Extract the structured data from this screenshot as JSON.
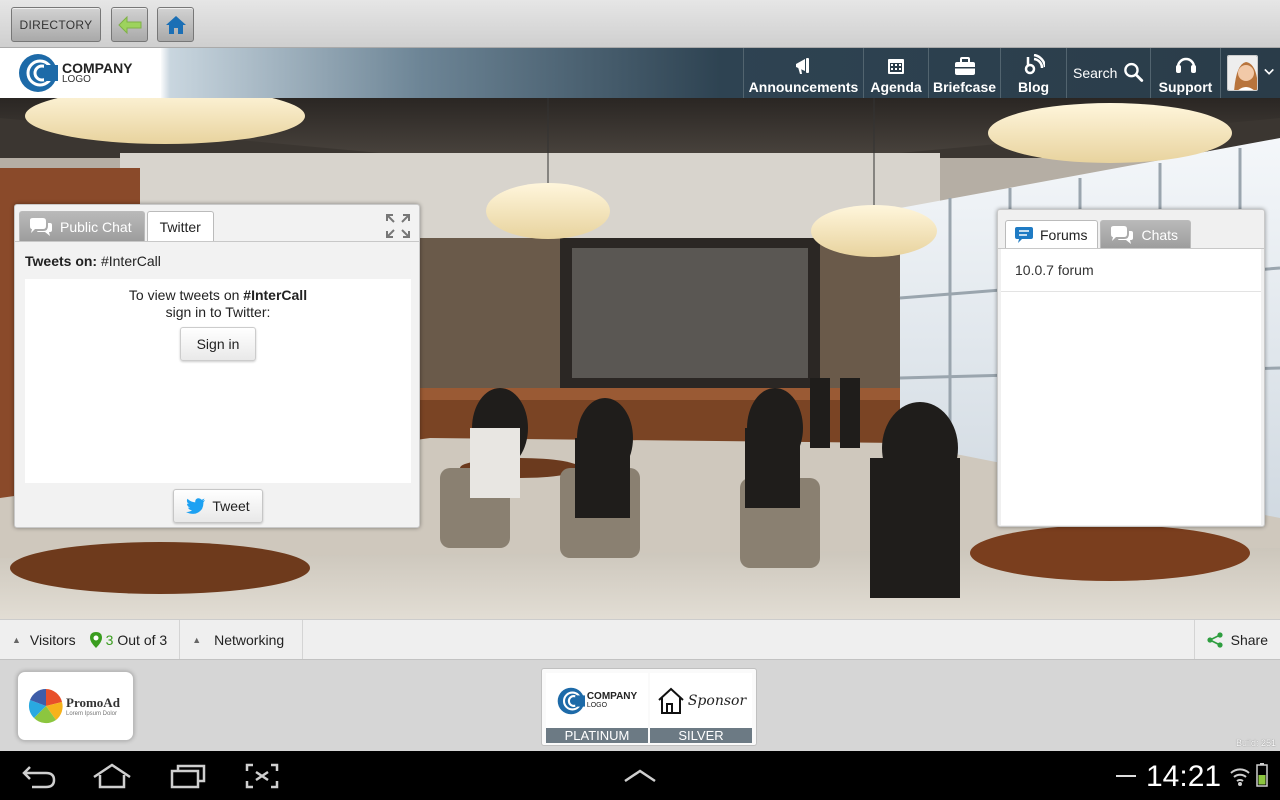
{
  "topbar": {
    "directory_label": "DIRECTORY",
    "back_icon": "back-arrow-icon",
    "home_icon": "home-icon"
  },
  "header": {
    "logo": {
      "line1": "COMPANY",
      "line2": "LOGO"
    },
    "nav": [
      {
        "label": "Announcements",
        "icon": "megaphone-icon"
      },
      {
        "label": "Agenda",
        "icon": "calendar-icon"
      },
      {
        "label": "Briefcase",
        "icon": "briefcase-icon"
      },
      {
        "label": "Blog",
        "icon": "blog-icon"
      },
      {
        "label": "Search",
        "icon": "search-icon"
      },
      {
        "label": "Support",
        "icon": "headset-icon"
      }
    ]
  },
  "twitter_panel": {
    "tabs": [
      {
        "label": "Public Chat",
        "active": false
      },
      {
        "label": "Twitter",
        "active": true
      }
    ],
    "tweets_on_label": "Tweets on:",
    "hashtag": "#InterCall",
    "message_line1_prefix": "To view tweets on ",
    "message_hashtag": "#InterCall",
    "message_line2": "sign in to Twitter:",
    "sign_in_label": "Sign in",
    "tweet_label": "Tweet"
  },
  "forums_panel": {
    "tabs": [
      {
        "label": "Forums",
        "active": true
      },
      {
        "label": "Chats",
        "active": false
      }
    ],
    "items": [
      "10.0.7 forum"
    ]
  },
  "statusbar": {
    "visitors_label": "Visitors",
    "visitors_count": "3",
    "visitors_suffix": "Out of 3",
    "networking_label": "Networking",
    "share_label": "Share"
  },
  "sponsors": {
    "promo": {
      "title": "PromoAd",
      "subtitle": "Lorem Ipsum Dolor"
    },
    "items": [
      {
        "tier": "PLATINUM",
        "logo_line1": "COMPANY",
        "logo_line2": "LOGO"
      },
      {
        "tier": "SILVER",
        "logo_text": "Sponsor"
      }
    ],
    "build": "Build: 251"
  },
  "system": {
    "time": "14:21"
  },
  "colors": {
    "header_dark": "#2a3c49",
    "twitter_blue": "#1da1f2",
    "visitors_green": "#3a9d1f",
    "share_green": "#2e9e3f",
    "forums_blue": "#1f7bc4"
  }
}
